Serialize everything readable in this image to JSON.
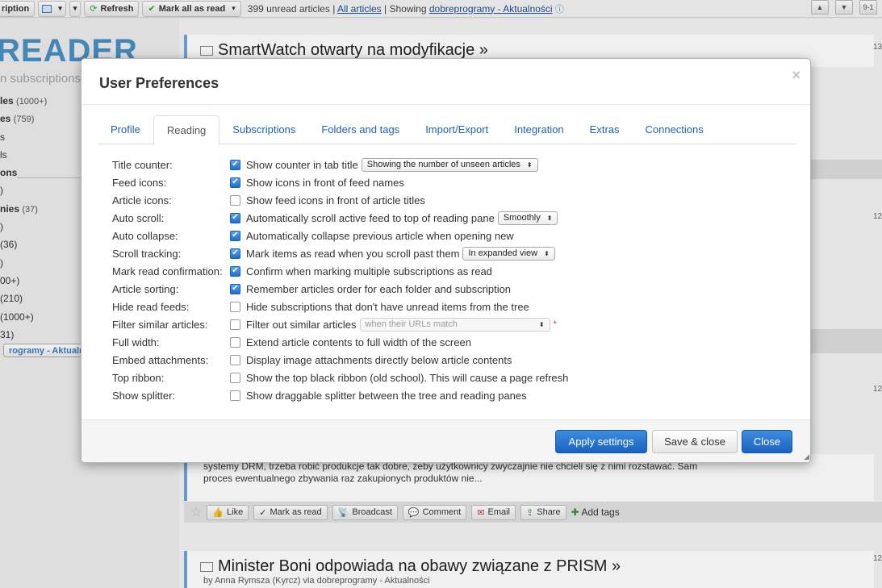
{
  "toolbar": {
    "subscription_label": "ription",
    "refresh_label": "Refresh",
    "mark_all_label": "Mark all as read",
    "unread_text": "399 unread articles",
    "sep": "|",
    "all_articles_link": "All articles",
    "showing_prefix": "| Showing",
    "showing_link": "dobreprogramy - Aktualności",
    "right_btn_3": "9-1"
  },
  "sidebar": {
    "logo": "READER",
    "search_placeholder": "n subscriptions",
    "items": [
      {
        "label": "les",
        "count": "(1000+)",
        "bold": true
      },
      {
        "label": "es",
        "count": "(759)",
        "bold": true
      },
      {
        "label": "s",
        "count": "",
        "bold": false
      },
      {
        "label": "ls",
        "count": "",
        "bold": false
      },
      {
        "label": "ons",
        "count": "",
        "bold": true
      },
      {
        "label": ")",
        "count": "",
        "bold": false
      },
      {
        "label": "nies",
        "count": "(37)",
        "bold": true
      },
      {
        "label": ")",
        "count": "",
        "bold": false
      },
      {
        "label": "(36)",
        "count": "",
        "bold": false
      },
      {
        "label": ")",
        "count": "",
        "bold": false
      },
      {
        "label": "00+)",
        "count": "",
        "bold": false
      },
      {
        "label": "(210)",
        "count": "",
        "bold": false
      },
      {
        "label": "(1000+)",
        "count": "",
        "bold": false
      },
      {
        "label": "31)",
        "count": "",
        "bold": false
      },
      {
        "label": "rogramy - Aktualn",
        "count": "",
        "bold": true
      }
    ]
  },
  "reading": {
    "article1_title": "SmartWatch otwarty na modyfikacje »",
    "article2_body_line1": "systemy DRM, trzeba robić produkcje tak dobre, żeby użytkownicy zwyczajnie nie chcieli się z nimi rozstawać. Sam",
    "article2_body_line2": "proces ewentualnego zbywania raz zakupionych produktów nie...",
    "article3_title": "Minister Boni odpowiada na obawy związane z PRISM »",
    "article3_by": "by Anna Rymsza (Kyrcz) via dobreprogramy - Aktualności",
    "side_num_1": "13",
    "side_num_2": "12",
    "side_num_3": "12",
    "side_num_4": "12",
    "actions": {
      "like": "Like",
      "mark_read": "Mark as read",
      "broadcast": "Broadcast",
      "comment": "Comment",
      "email": "Email",
      "share": "Share",
      "add_tags": "Add tags"
    }
  },
  "modal": {
    "title": "User Preferences",
    "close_glyph": "×",
    "tabs": [
      {
        "label": "Profile"
      },
      {
        "label": "Reading"
      },
      {
        "label": "Subscriptions"
      },
      {
        "label": "Folders and tags"
      },
      {
        "label": "Import/Export"
      },
      {
        "label": "Integration"
      },
      {
        "label": "Extras"
      },
      {
        "label": "Connections"
      }
    ],
    "active_tab": "Reading",
    "prefs": [
      {
        "label": "Title counter:",
        "checked": true,
        "desc": "Show counter in tab title",
        "select": "Showing the number of unseen articles",
        "disabled": false,
        "required": false
      },
      {
        "label": "Feed icons:",
        "checked": true,
        "desc": "Show icons in front of feed names",
        "select": "",
        "disabled": false,
        "required": false
      },
      {
        "label": "Article icons:",
        "checked": false,
        "desc": "Show feed icons in front of article titles",
        "select": "",
        "disabled": false,
        "required": false
      },
      {
        "label": "Auto scroll:",
        "checked": true,
        "desc": "Automatically scroll active feed to top of reading pane",
        "select": "Smoothly",
        "disabled": false,
        "required": false
      },
      {
        "label": "Auto collapse:",
        "checked": true,
        "desc": "Automatically collapse previous article when opening new",
        "select": "",
        "disabled": false,
        "required": false
      },
      {
        "label": "Scroll tracking:",
        "checked": true,
        "desc": "Mark items as read when you scroll past them",
        "select": "In expanded view",
        "disabled": false,
        "required": false
      },
      {
        "label": "Mark read confirmation:",
        "checked": true,
        "desc": "Confirm when marking multiple subscriptions as read",
        "select": "",
        "disabled": false,
        "required": false
      },
      {
        "label": "Article sorting:",
        "checked": true,
        "desc": "Remember articles order for each folder and subscription",
        "select": "",
        "disabled": false,
        "required": false
      },
      {
        "label": "Hide read feeds:",
        "checked": false,
        "desc": "Hide subscriptions that don't have unread items from the tree",
        "select": "",
        "disabled": false,
        "required": false
      },
      {
        "label": "Filter similar articles:",
        "checked": false,
        "desc": "Filter out similar articles",
        "select": "when their URLs match",
        "disabled": true,
        "required": true
      },
      {
        "label": "Full width:",
        "checked": false,
        "desc": "Extend article contents to full width of the screen",
        "select": "",
        "disabled": false,
        "required": false
      },
      {
        "label": "Embed attachments:",
        "checked": false,
        "desc": "Display image attachments directly below article contents",
        "select": "",
        "disabled": false,
        "required": false
      },
      {
        "label": "Top ribbon:",
        "checked": false,
        "desc": "Show the top black ribbon (old school). This will cause a page refresh",
        "select": "",
        "disabled": false,
        "required": false
      },
      {
        "label": "Show splitter:",
        "checked": false,
        "desc": "Show draggable splitter between the tree and reading panes",
        "select": "",
        "disabled": false,
        "required": false
      }
    ],
    "required_mark": "*",
    "buttons": {
      "apply": "Apply settings",
      "save_close": "Save & close",
      "close": "Close"
    }
  }
}
